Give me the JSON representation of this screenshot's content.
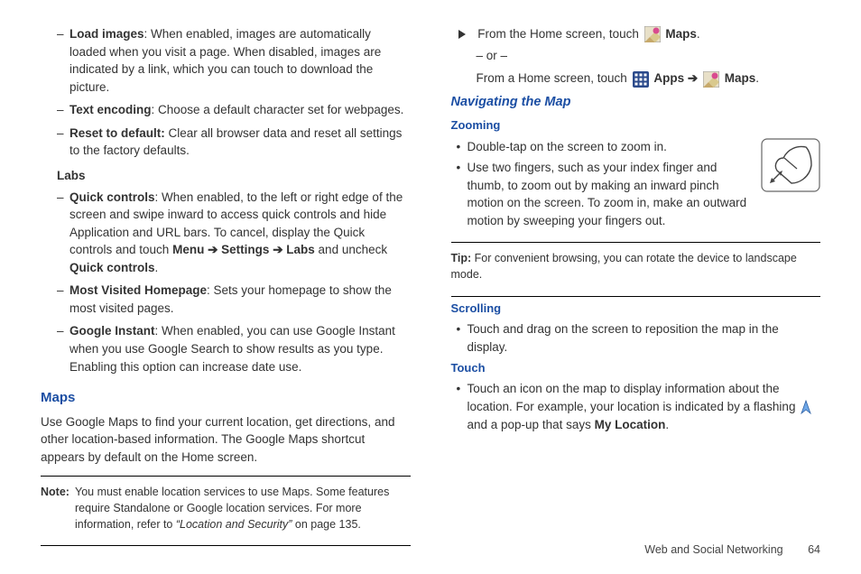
{
  "left": {
    "items1": [
      {
        "title": "Load images",
        "body": ": When enabled, images are automatically loaded when you visit a page. When disabled, images are indicated by a link, which you can touch to download the picture."
      },
      {
        "title": "Text encoding",
        "body": ": Choose a default character set for webpages."
      },
      {
        "title": "Reset to default:",
        "body": " Clear all browser data and reset all settings to the factory defaults."
      }
    ],
    "labs_heading": "Labs",
    "labs_qc_title": "Quick controls",
    "labs_qc_body1": ": When enabled, to the left or right edge of the screen and swipe inward to access quick controls and hide Application and URL bars. To cancel, display the Quick controls and touch ",
    "labs_qc_menu": "Menu",
    "labs_qc_arrow1": "➔",
    "labs_qc_settings": "Settings",
    "labs_qc_arrow2": "➔",
    "labs_qc_labs": "Labs",
    "labs_qc_body2": " and uncheck ",
    "labs_qc_qc2": "Quick controls",
    "labs_qc_period": ".",
    "labs_mvh_title": "Most Visited Homepage",
    "labs_mvh_body": ": Sets your homepage to show the most visited pages.",
    "labs_gi_title": "Google Instant",
    "labs_gi_body": ": When enabled, you can use Google Instant when you use Google Search to show results as you type. Enabling this option can increase date use.",
    "maps_heading": "Maps",
    "maps_para": "Use Google Maps to find your current location, get directions, and other location-based information. The Google Maps shortcut appears by default on the Home screen.",
    "note_label": "Note:",
    "note_body1": "You must enable location services to use Maps. Some features require Standalone or Google location services. For more information, refer to ",
    "note_ref": "“Location and Security”",
    "note_body2": "  on page 135."
  },
  "right": {
    "step1a": "From the Home screen, touch ",
    "maps_label": "Maps",
    "or": "– or –",
    "step1b": "From a Home screen, touch ",
    "apps_label": "Apps",
    "arrow": "➔",
    "nav_heading": "Navigating the Map",
    "zoom_heading": "Zooming",
    "zoom_b1": "Double-tap on the screen to zoom in.",
    "zoom_b2": "Use two fingers, such as your index finger and thumb, to zoom out by making an inward pinch motion on the screen. To zoom in, make an outward motion by sweeping your fingers out.",
    "tip_label": "Tip:",
    "tip_body": " For convenient browsing, you can rotate the device to landscape mode.",
    "scroll_heading": "Scrolling",
    "scroll_b1": "Touch and drag on the screen to reposition the map in the display.",
    "touch_heading": "Touch",
    "touch_b1a": "Touch an icon on the map to display information about the location. For example, your location is indicated by a flashing ",
    "touch_b1b": " and a pop-up that says ",
    "touch_myloc": "My Location",
    "touch_period": "."
  },
  "footer": {
    "chapter": "Web and Social Networking",
    "page": "64"
  }
}
